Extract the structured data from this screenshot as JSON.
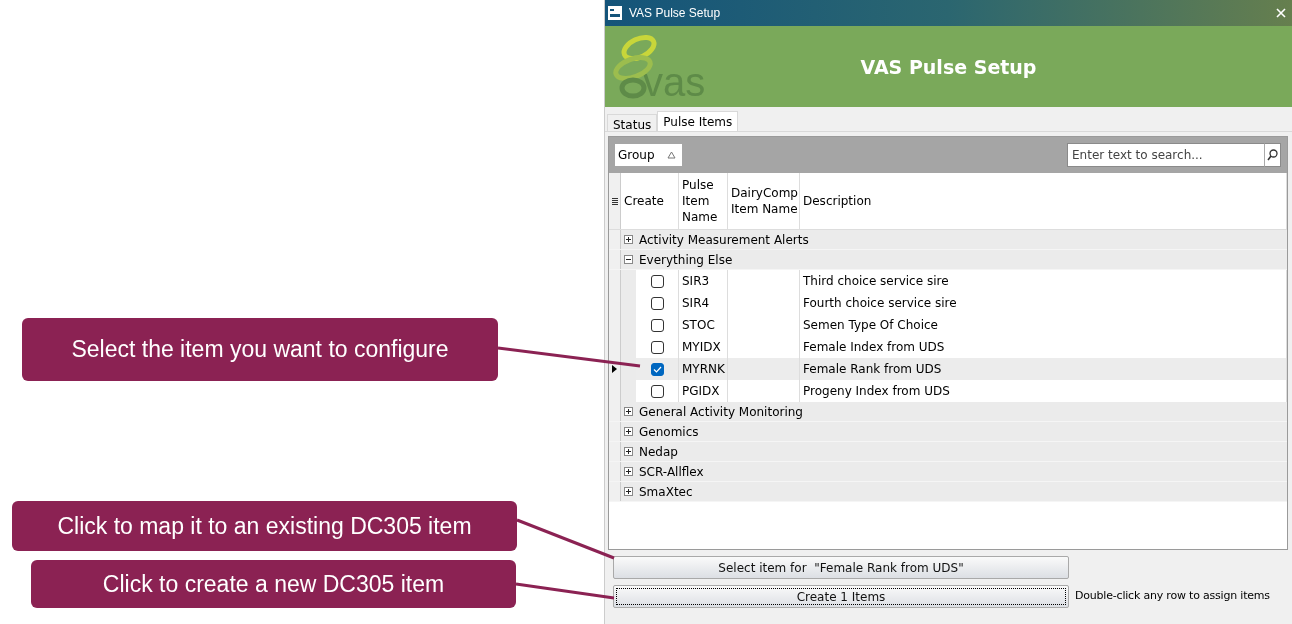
{
  "callouts": [
    {
      "text": "Select the item you want to configure"
    },
    {
      "text": "Click to map it to an existing DC305 item"
    },
    {
      "text": "Click to create a new DC305 item"
    }
  ],
  "window": {
    "title": "VAS Pulse Setup"
  },
  "banner": {
    "logo_text": "vas",
    "heading": "VAS Pulse Setup"
  },
  "tabs": [
    {
      "label": "Status",
      "selected": false
    },
    {
      "label": "Pulse Items",
      "selected": true
    }
  ],
  "group_panel": {
    "chip": "Group",
    "search": {
      "placeholder": "Enter text to search..."
    }
  },
  "table": {
    "columns": [
      "Create",
      "Pulse Item Name",
      "DairyComp Item Name",
      "Description"
    ],
    "groups": [
      {
        "name": "Activity Measurement Alerts",
        "expanded": false
      },
      {
        "name": "Everything Else",
        "expanded": true,
        "rows": [
          {
            "checked": false,
            "selected": false,
            "pulse_item": "SIR3",
            "description": "Third choice service sire"
          },
          {
            "checked": false,
            "selected": false,
            "pulse_item": "SIR4",
            "description": "Fourth choice service sire"
          },
          {
            "checked": false,
            "selected": false,
            "pulse_item": "STOC",
            "description": "Semen Type Of Choice"
          },
          {
            "checked": false,
            "selected": false,
            "pulse_item": "MYIDX",
            "description": "Female Index from UDS"
          },
          {
            "checked": true,
            "selected": true,
            "pulse_item": "MYRNK",
            "description": "Female Rank from UDS"
          },
          {
            "checked": false,
            "selected": false,
            "pulse_item": "PGIDX",
            "description": "Progeny Index from UDS"
          }
        ]
      },
      {
        "name": "General Activity Monitoring",
        "expanded": false
      },
      {
        "name": "Genomics",
        "expanded": false
      },
      {
        "name": "Nedap",
        "expanded": false
      },
      {
        "name": "SCR-Allflex",
        "expanded": false
      },
      {
        "name": "SmaXtec",
        "expanded": false
      }
    ]
  },
  "buttons": [
    {
      "label": "Select item for  \"Female Rank from UDS\"",
      "focused": false
    },
    {
      "label": "Create 1 Items",
      "focused": true
    }
  ],
  "hint": "Double-click any row to assign items"
}
